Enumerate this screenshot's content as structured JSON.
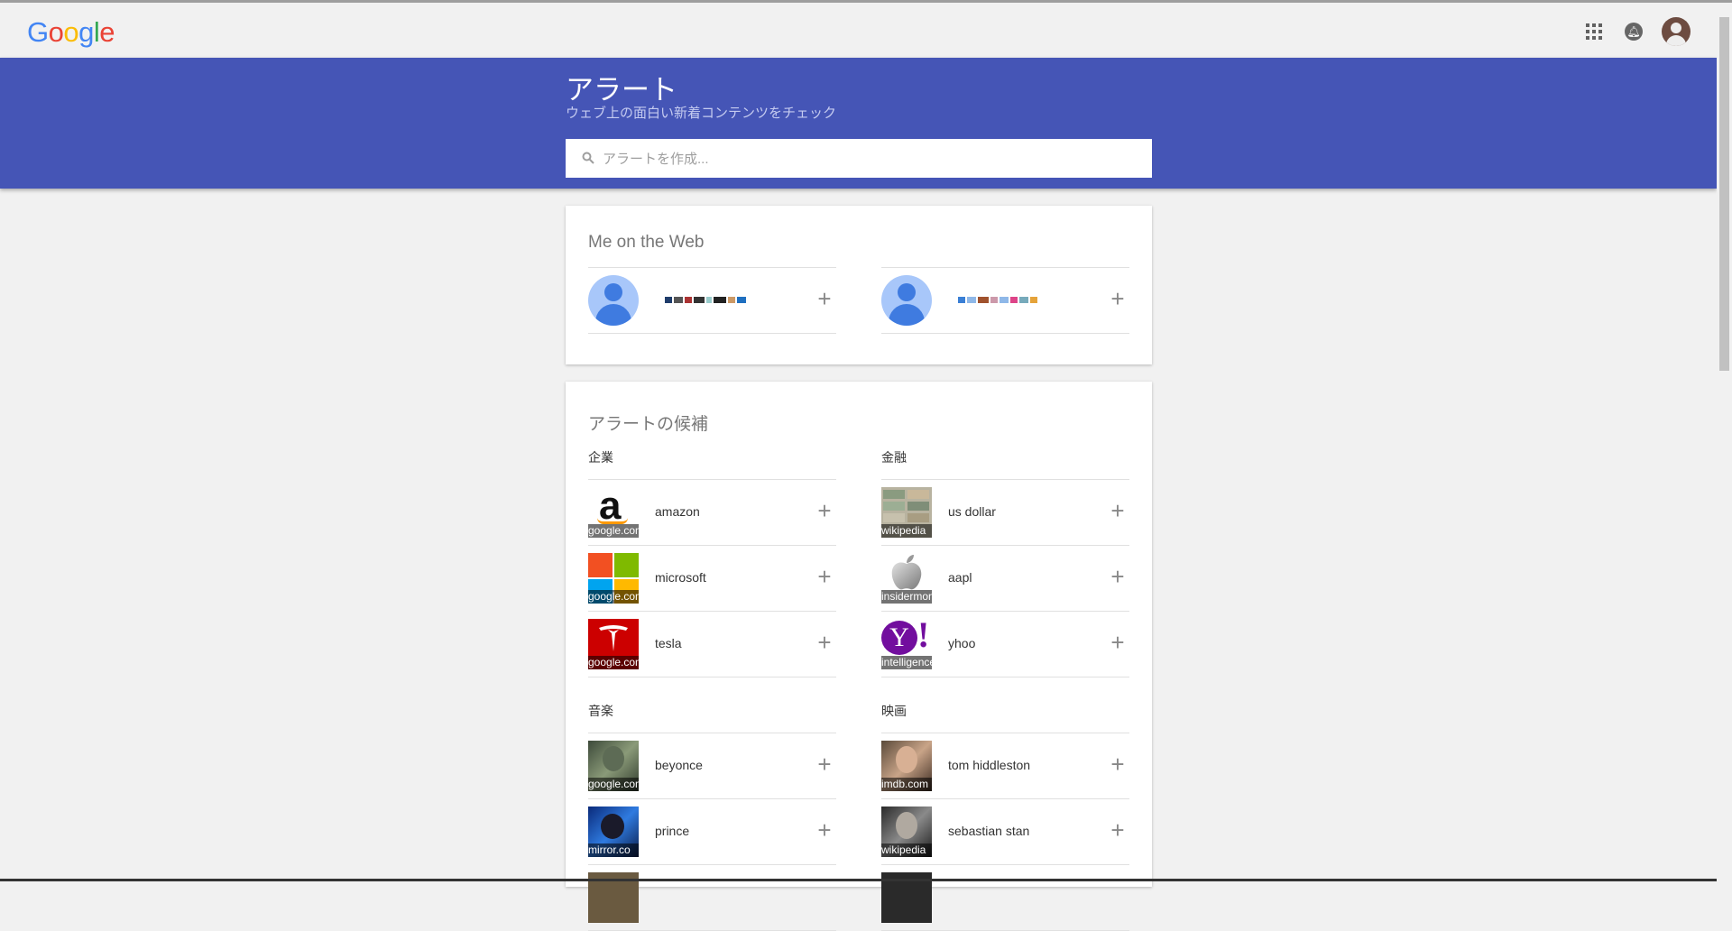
{
  "logo": {
    "letters": [
      "G",
      "o",
      "o",
      "g",
      "l",
      "e"
    ],
    "colors": [
      "#4285f4",
      "#ea4335",
      "#fbbc05",
      "#4285f4",
      "#34a853",
      "#ea4335"
    ]
  },
  "header": {
    "title": "アラート",
    "subtitle": "ウェブ上の面白い新着コンテンツをチェック"
  },
  "search": {
    "placeholder": "アラートを作成..."
  },
  "me_on_web": {
    "title": "Me on the Web",
    "people": [
      {
        "label": "",
        "pixel_colors": [
          "#1f3d6b",
          "#555",
          "#a33",
          "#333",
          "#9cc",
          "#222",
          "#c96",
          "#1f6fc0"
        ]
      },
      {
        "label": "",
        "pixel_colors": [
          "#3a7fd5",
          "#8fb8e8",
          "#a0522d",
          "#c9a",
          "#8fb8e8",
          "#d48",
          "#7ab",
          "#e5a33a"
        ]
      }
    ]
  },
  "suggestions": {
    "title": "アラートの候補",
    "groups": [
      {
        "name": "企業",
        "items": [
          {
            "label": "amazon",
            "source": "google.com"
          },
          {
            "label": "microsoft",
            "source": "google.com"
          },
          {
            "label": "tesla",
            "source": "google.com"
          }
        ]
      },
      {
        "name": "金融",
        "items": [
          {
            "label": "us dollar",
            "source": "wikipedia"
          },
          {
            "label": "aapl",
            "source": "insidermonkey"
          },
          {
            "label": "yhoo",
            "source": "intelligence"
          }
        ]
      },
      {
        "name": "音楽",
        "items": [
          {
            "label": "beyonce",
            "source": "google.com"
          },
          {
            "label": "prince",
            "source": "mirror.co"
          }
        ]
      },
      {
        "name": "映画",
        "items": [
          {
            "label": "tom hiddleston",
            "source": "imdb.com"
          },
          {
            "label": "sebastian stan",
            "source": "wikipedia"
          }
        ]
      }
    ]
  },
  "icons": {
    "apps": "apps-grid-icon",
    "notifications": "bell-icon",
    "account": "account-avatar",
    "add": "+"
  }
}
